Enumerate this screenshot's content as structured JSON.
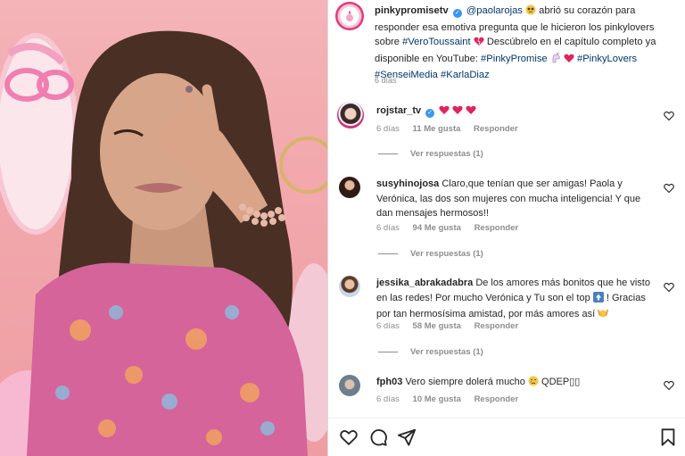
{
  "post": {
    "author": "pinkypromisetv",
    "mention": "@paolarojas",
    "text_1": "abrió su corazón para responder esa emotiva pregunta que le hicieron los pinkylovers sobre",
    "hashtag_1": "#VeroToussaint",
    "text_2": "Descúbrelo en el capítulo completo ya disponible en YouTube:",
    "hashtag_2": "#PinkyPromise",
    "hashtag_3": "#PinkyLovers",
    "hashtag_4": "#SenseiMedia",
    "hashtag_5": "#KarlaDiaz",
    "time": "6 días"
  },
  "comments": [
    {
      "user": "rojstar_tv",
      "verified": true,
      "text": "",
      "time": "6 días",
      "likes": "11 Me gusta",
      "reply": "Responder",
      "view_replies": "Ver respuestas (1)"
    },
    {
      "user": "susyhinojosa",
      "text": "Claro,que tenían que ser amigas! Paola y Verónica, las dos son mujeres con mucha inteligencia! Y que dan mensajes hermosos!!",
      "time": "6 días",
      "likes": "94 Me gusta",
      "reply": "Responder",
      "view_replies": "Ver respuestas (1)"
    },
    {
      "user": "jessika_abrakadabra",
      "text_a": "De los amores más bonitos que he visto en las redes! Por mucho Verónica y Tu son el top",
      "text_b": "! Gracias por tan hermosísima amistad, por más amores así",
      "time": "6 días",
      "likes": "58 Me gusta",
      "reply": "Responder",
      "view_replies": "Ver respuestas (1)"
    },
    {
      "user": "fph03",
      "text": "Vero siempre dolerá mucho",
      "text_tail": "QDEP",
      "time": "6 días",
      "likes": "10 Me gusta",
      "reply": "Responder"
    }
  ],
  "icons": {
    "heart": "heart-icon",
    "comment": "comment-icon",
    "share": "share-icon",
    "save": "bookmark-icon"
  },
  "colors": {
    "link": "#00376b",
    "verified": "#3897f0",
    "red_heart": "#e0245e",
    "background_pink": "#f2a9ad"
  }
}
